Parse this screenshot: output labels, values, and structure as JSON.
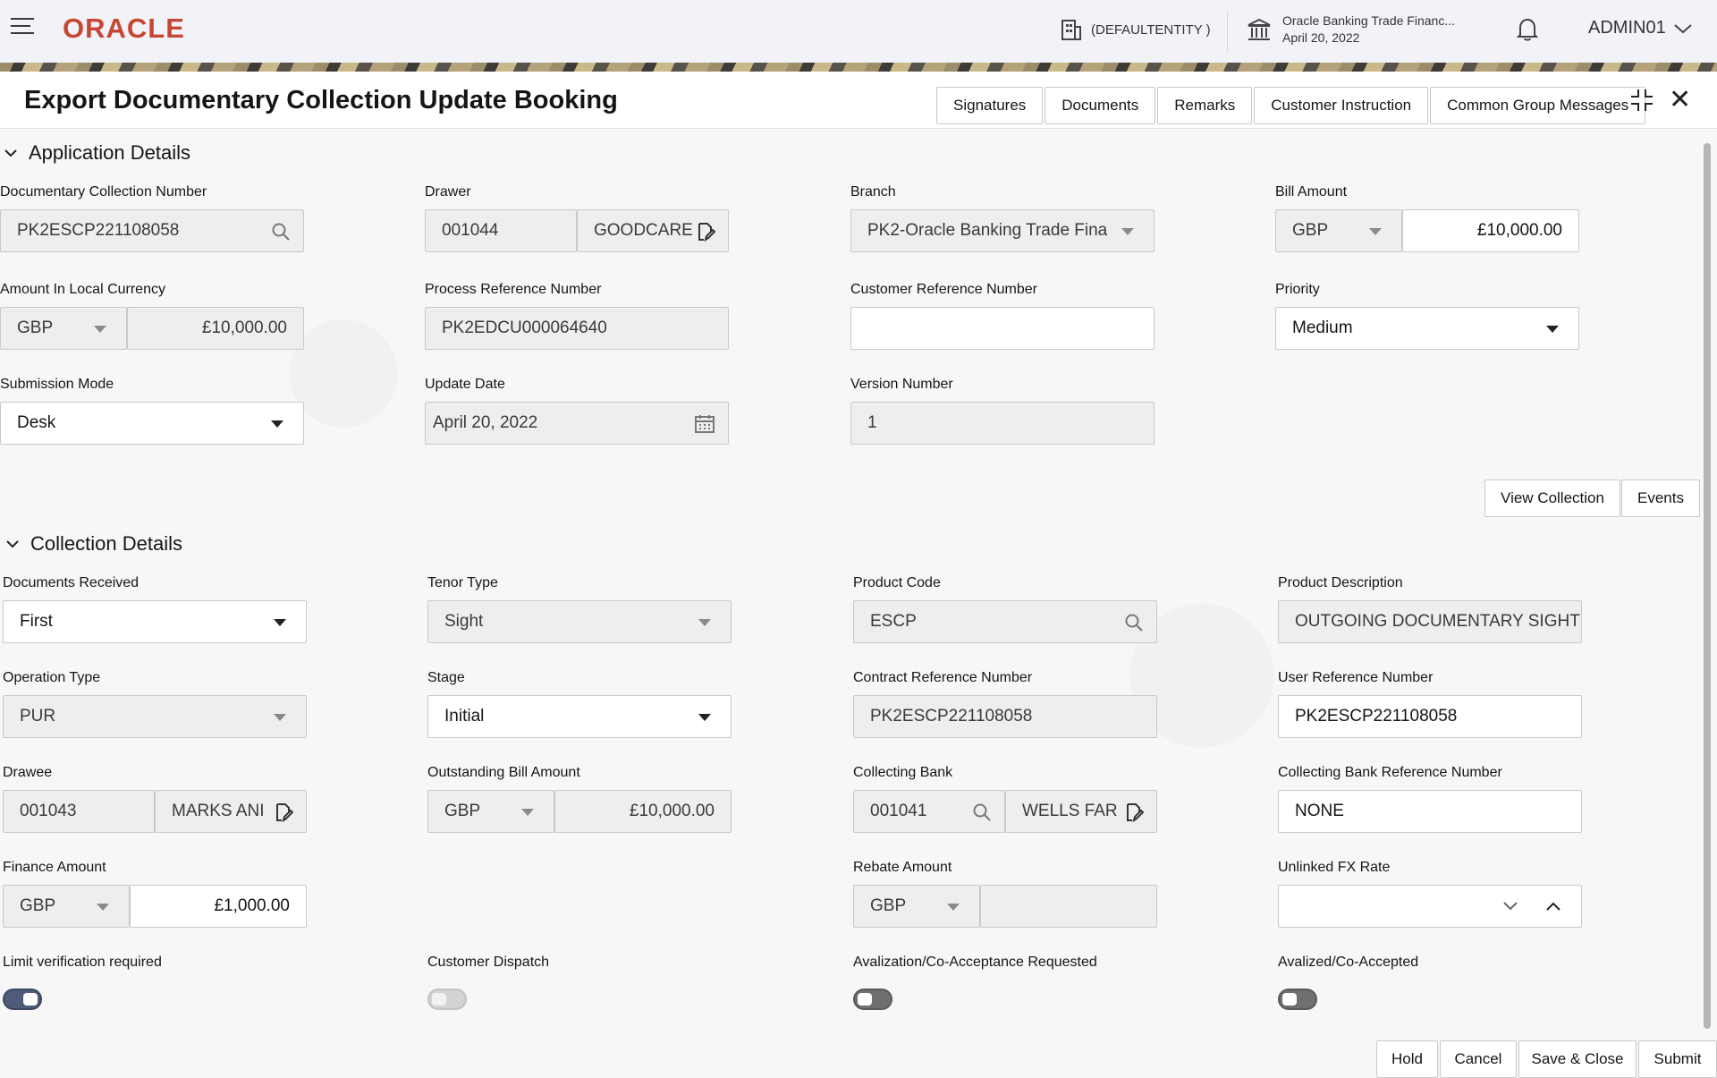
{
  "header": {
    "logo": "ORACLE",
    "entity": "(DEFAULTENTITY )",
    "bank_name": "Oracle Banking Trade Financ...",
    "bank_date": "April 20, 2022",
    "user": "ADMIN01"
  },
  "page": {
    "title": "Export Documentary Collection Update Booking",
    "tabs": [
      "Signatures",
      "Documents",
      "Remarks",
      "Customer Instruction",
      "Common Group Messages"
    ]
  },
  "application_details": {
    "heading": "Application Details",
    "doc_collection_number": {
      "label": "Documentary Collection Number",
      "value": "PK2ESCP221108058"
    },
    "drawer": {
      "label": "Drawer",
      "id": "001044",
      "name": "GOODCARE"
    },
    "branch": {
      "label": "Branch",
      "value": "PK2-Oracle Banking Trade Fina"
    },
    "bill_amount": {
      "label": "Bill Amount",
      "currency": "GBP",
      "value": "£10,000.00"
    },
    "amount_local": {
      "label": "Amount In Local Currency",
      "currency": "GBP",
      "value": "£10,000.00"
    },
    "process_ref": {
      "label": "Process Reference Number",
      "value": "PK2EDCU000064640"
    },
    "customer_ref": {
      "label": "Customer Reference Number",
      "value": ""
    },
    "priority": {
      "label": "Priority",
      "value": "Medium"
    },
    "submission_mode": {
      "label": "Submission Mode",
      "value": "Desk"
    },
    "update_date": {
      "label": "Update Date",
      "value": "April 20, 2022"
    },
    "version_number": {
      "label": "Version Number",
      "value": "1"
    },
    "view_collection": "View Collection",
    "events": "Events"
  },
  "collection_details": {
    "heading": "Collection Details",
    "documents_received": {
      "label": "Documents Received",
      "value": "First"
    },
    "tenor_type": {
      "label": "Tenor Type",
      "value": "Sight"
    },
    "product_code": {
      "label": "Product Code",
      "value": "ESCP"
    },
    "product_description": {
      "label": "Product Description",
      "value": "OUTGOING DOCUMENTARY SIGHT"
    },
    "operation_type": {
      "label": "Operation Type",
      "value": "PUR"
    },
    "stage": {
      "label": "Stage",
      "value": "Initial"
    },
    "contract_ref": {
      "label": "Contract Reference Number",
      "value": "PK2ESCP221108058"
    },
    "user_ref": {
      "label": "User Reference Number",
      "value": "PK2ESCP221108058"
    },
    "drawee": {
      "label": "Drawee",
      "id": "001043",
      "name": "MARKS ANI"
    },
    "outstanding_bill": {
      "label": "Outstanding Bill Amount",
      "currency": "GBP",
      "value": "£10,000.00"
    },
    "collecting_bank": {
      "label": "Collecting Bank",
      "id": "001041",
      "name": "WELLS FAR"
    },
    "collecting_bank_ref": {
      "label": "Collecting Bank Reference Number",
      "value": "NONE"
    },
    "finance_amount": {
      "label": "Finance Amount",
      "currency": "GBP",
      "value": "£1,000.00"
    },
    "rebate_amount": {
      "label": "Rebate Amount",
      "currency": "GBP",
      "value": ""
    },
    "unlinked_fx_rate": {
      "label": "Unlinked FX Rate",
      "value": ""
    },
    "limit_verification": {
      "label": "Limit verification required",
      "on": true
    },
    "customer_dispatch": {
      "label": "Customer Dispatch",
      "on": false
    },
    "avalization_requested": {
      "label": "Avalization/Co-Acceptance Requested",
      "on": false
    },
    "avalized": {
      "label": "Avalized/Co-Accepted",
      "on": false
    }
  },
  "footer": {
    "hold": "Hold",
    "cancel": "Cancel",
    "save_close": "Save & Close",
    "submit": "Submit"
  }
}
